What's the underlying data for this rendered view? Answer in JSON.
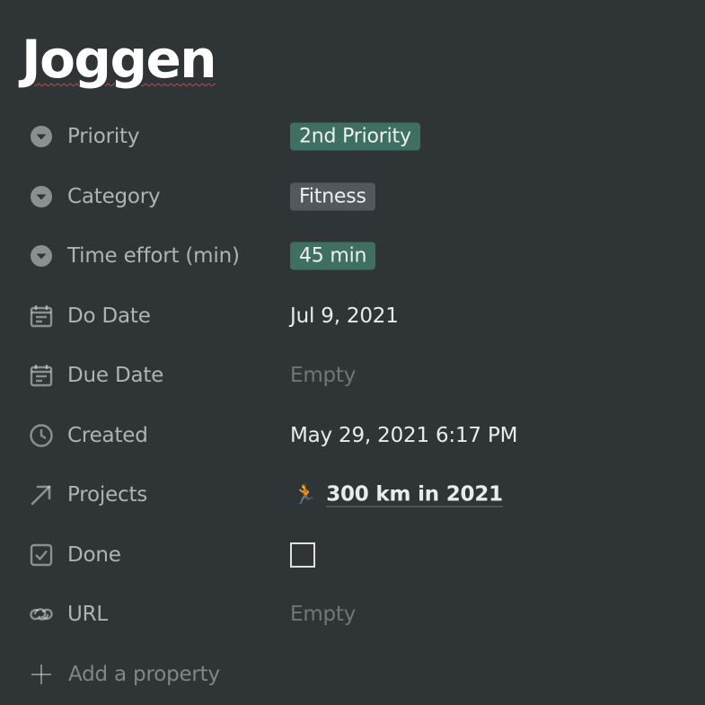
{
  "page": {
    "title": "Joggen"
  },
  "properties": [
    {
      "icon": "select-icon",
      "label": "Priority",
      "value": "2nd Priority",
      "type": "tag",
      "color": "#3e6f61"
    },
    {
      "icon": "select-icon",
      "label": "Category",
      "value": "Fitness",
      "type": "tag",
      "color": "#53585c"
    },
    {
      "icon": "select-icon",
      "label": "Time effort (min)",
      "value": "45 min",
      "type": "tag",
      "color": "#3e6f61"
    },
    {
      "icon": "calendar-icon",
      "label": "Do Date",
      "value": "Jul 9, 2021",
      "type": "text"
    },
    {
      "icon": "calendar-icon",
      "label": "Due Date",
      "value": "Empty",
      "type": "empty"
    },
    {
      "icon": "clock-icon",
      "label": "Created",
      "value": "May 29, 2021 6:17 PM",
      "type": "text"
    },
    {
      "icon": "relation-arrow-icon",
      "label": "Projects",
      "value": "300 km in 2021",
      "emoji": "🏃",
      "type": "relation"
    },
    {
      "icon": "checkbox-icon",
      "label": "Done",
      "value": false,
      "type": "checkbox"
    },
    {
      "icon": "link-icon",
      "label": "URL",
      "value": "Empty",
      "type": "empty"
    }
  ],
  "add_property": {
    "label": "Add a property"
  },
  "colors": {
    "background": "#2f3437",
    "tag_green": "#3e6f61",
    "tag_gray": "#53585c"
  }
}
